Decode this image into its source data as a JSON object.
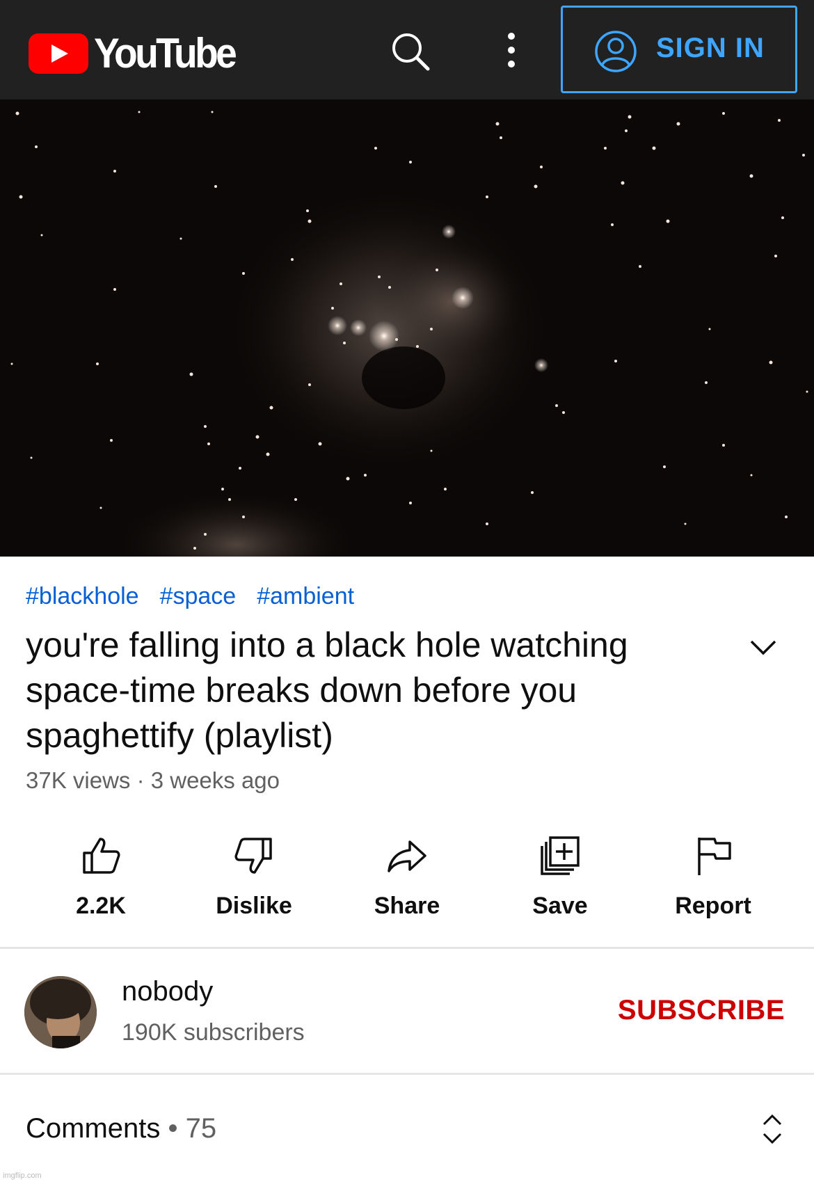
{
  "header": {
    "logo_text": "YouTube",
    "signin_label": "SIGN IN",
    "icons": [
      "youtube-logo",
      "search-icon",
      "more-vert-icon",
      "account-circle-icon"
    ],
    "accent_color": "#3ea6ff",
    "background_color": "#212121"
  },
  "video": {
    "hashtags": [
      "#blackhole",
      "#space",
      "#ambient"
    ],
    "title": "you're falling into a black hole watching space-time breaks down before you spaghettify (playlist)",
    "views_line": "37K views · 3 weeks ago"
  },
  "actions": [
    {
      "icon": "thumb-up-icon",
      "label": "2.2K"
    },
    {
      "icon": "thumb-down-icon",
      "label": "Dislike"
    },
    {
      "icon": "share-icon",
      "label": "Share"
    },
    {
      "icon": "save-playlist-icon",
      "label": "Save"
    },
    {
      "icon": "flag-icon",
      "label": "Report"
    }
  ],
  "channel": {
    "name": "nobody",
    "subscribers": "190K subscribers",
    "subscribe_label": "SUBSCRIBE",
    "subscribe_color": "#cc0000"
  },
  "comments": {
    "label": "Comments",
    "separator": " • ",
    "count": "75"
  },
  "watermark": "imgflip.com"
}
